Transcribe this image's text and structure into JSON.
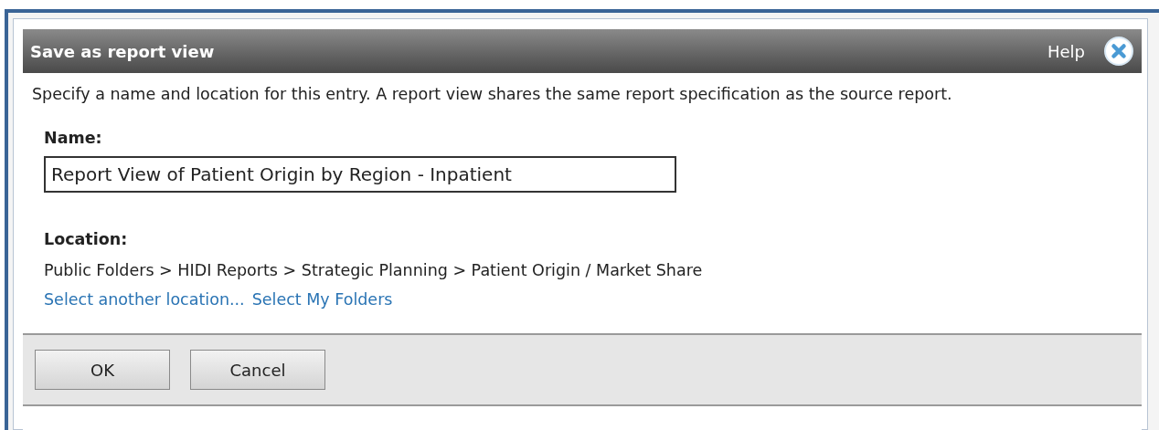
{
  "dialog": {
    "title": "Save as report view",
    "help": "Help",
    "description": "Specify a name and location for this entry. A report view shares the same report specification as the source report.",
    "name_label": "Name:",
    "name_value": "Report View of Patient Origin by Region - Inpatient",
    "location_label": "Location:",
    "location_path": "Public Folders > HIDI Reports > Strategic Planning > Patient Origin / Market Share",
    "links": [
      "Select another location...",
      "Select My Folders"
    ],
    "buttons": [
      "OK",
      "Cancel"
    ]
  }
}
